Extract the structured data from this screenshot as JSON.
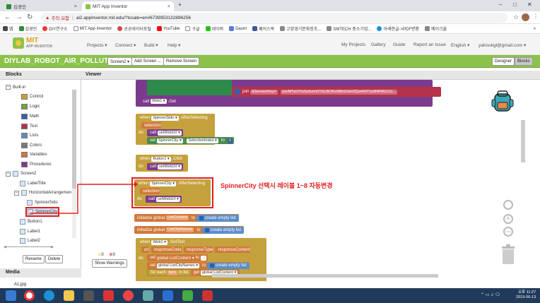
{
  "browser": {
    "tabs": [
      {
        "label": "김경민"
      },
      {
        "label": "MIT App Inventor"
      }
    ],
    "new_tab": "+",
    "security_label": "주의 요함",
    "url": "ai2.appinventor.mit.edu/?locale=en#6739953132896256",
    "bookmarks": [
      "앱",
      "김경민",
      "DIY연구소",
      "MIT App Inventor",
      "공공데이터포털",
      "YouTube",
      "구글",
      "네이버",
      "Daum",
      "페이스북",
      "고양경기문화창조...",
      "SMTECH 중소기업...",
      "아래한글->PDF변환",
      "메이크올"
    ],
    "bookmark_more": "»"
  },
  "app": {
    "logo_top": "MIT",
    "logo_bottom": "APP INVENTOR",
    "menus": [
      "Projects ▾",
      "Connect ▾",
      "Build ▾",
      "Help ▾"
    ],
    "right_menus": [
      "My Projects",
      "Gallery",
      "Guide",
      "Report an Issue",
      "English ▾",
      "yahookgl@gmail.com ▾"
    ],
    "project_title": "DIYLAB_ROBOT_AIR_POLLUTION1",
    "screen_button": "Screen2 ▾",
    "add_screen": "Add Screen ...",
    "remove_screen": "Remove Screen",
    "designer": "Designer",
    "blocks": "Blocks"
  },
  "blocks_panel": {
    "title": "Blocks",
    "builtin": "Built-in",
    "builtin_items": [
      {
        "label": "Control",
        "color": "#c4a13c"
      },
      {
        "label": "Logic",
        "color": "#7aa23a"
      },
      {
        "label": "Math",
        "color": "#3560a8"
      },
      {
        "label": "Text",
        "color": "#b4324a"
      },
      {
        "label": "Lists",
        "color": "#5b8ec9"
      },
      {
        "label": "Colors",
        "color": "#7a7a7a"
      },
      {
        "label": "Variables",
        "color": "#d0783a"
      },
      {
        "label": "Procedures",
        "color": "#7c3a8c"
      }
    ],
    "screen": "Screen2",
    "components": [
      "LabelTitle",
      "HorizontalArrangemen",
      "SpinnerSido",
      "SpinnerCity",
      "Button1",
      "Label1",
      "Label2"
    ],
    "rename": "Rename",
    "delete": "Delete"
  },
  "media": {
    "title": "Media",
    "files": [
      "A1.jpg"
    ]
  },
  "viewer": {
    "title": "Viewer",
    "annotation": "SpinnerCity 선택시 레이블 1~8 자동변경",
    "warnings_count": "0",
    "errors_count": "0",
    "show_warnings": "Show Warnings",
    "blocks": {
      "join": "join",
      "service_key": "&ServiceKey=",
      "key_value": "ize/MTwOVuSvihzmOYoLBOKeIMbIZnkH3Qw4XP1a9NRtRU1U...",
      "call_get": [
        "call",
        "Web1 ▾",
        ".Get"
      ],
      "when_sido": [
        "when",
        "SpinnerSido ▾",
        ".AfterSelecting"
      ],
      "selection": "selection",
      "do": "do",
      "call_seturl": [
        "call",
        "setWebUrl ▾"
      ],
      "set_sido": [
        "set",
        "SpinnerCity ▾",
        ".",
        "SelectionIndex ▾",
        "to",
        "1"
      ],
      "when_button": [
        "when",
        "Button1 ▾",
        ".Click"
      ],
      "when_city": [
        "when",
        "SpinnerCity ▾",
        ".AfterSelecting"
      ],
      "init_content": [
        "initialize global",
        "ListContent",
        "to",
        "create empty list"
      ],
      "init_citynames": [
        "initialize global",
        "ListCityNames",
        "to",
        "create empty list"
      ],
      "when_web": [
        "when",
        "Web1 ▾",
        ".GotText"
      ],
      "url_params": [
        "url",
        "responseCode",
        "responseType",
        "responseContent"
      ],
      "set_content": [
        "set",
        "global ListContent ▾",
        "to",
        "..."
      ],
      "set_citynames": [
        "set",
        "global ListCityNames ▾",
        "to",
        "create empty list"
      ],
      "for_each": [
        "for each",
        "item",
        "in list",
        "get",
        "global ListContent ▾"
      ]
    }
  },
  "taskbar": {
    "time": "오후 11:27",
    "date": "2019-06-13"
  },
  "colors": {
    "accent_green": "#8bc34a",
    "event_gold": "#c4a13c",
    "procedure_purple": "#7c3a8c",
    "annotation_red": "#e02020"
  }
}
